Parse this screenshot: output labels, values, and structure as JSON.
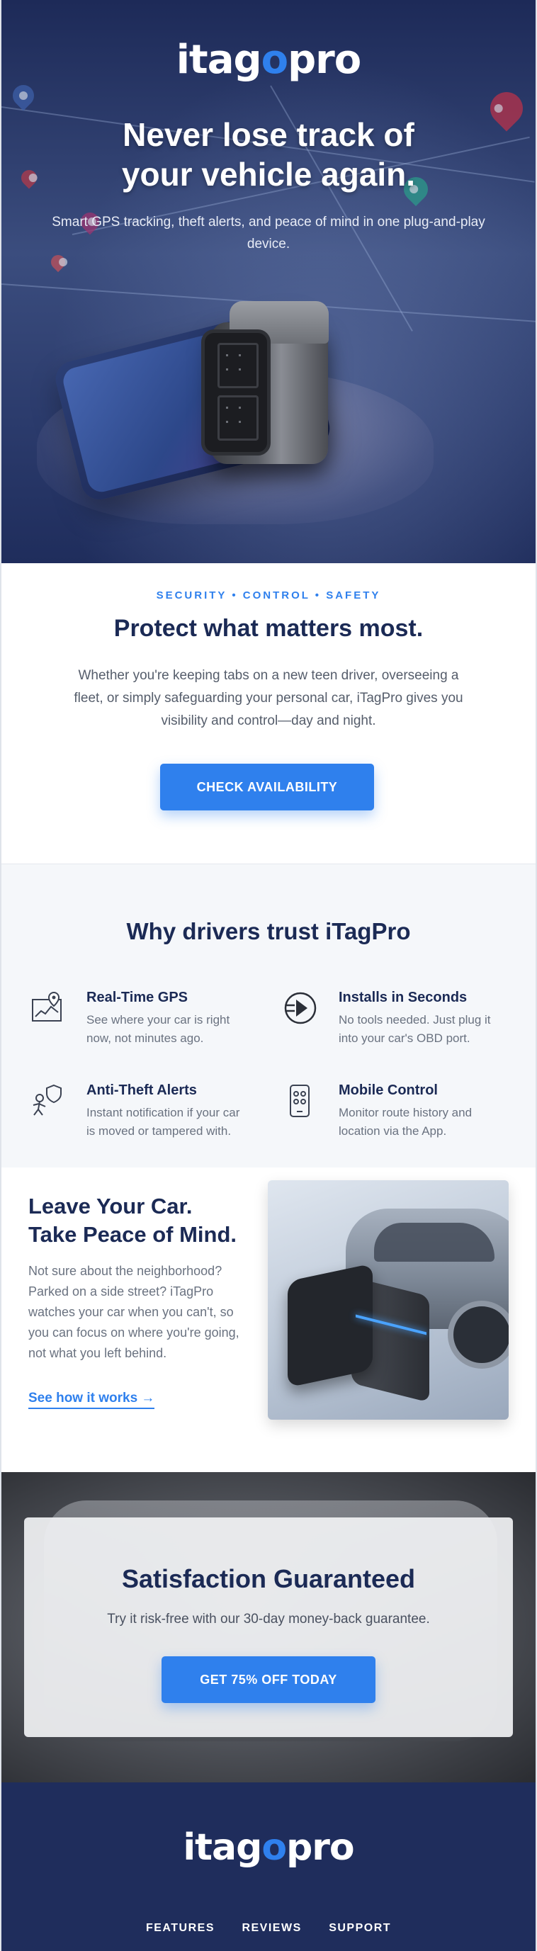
{
  "brand": {
    "logo_pre": "itag",
    "logo_dot": "o",
    "logo_post": "pro",
    "primary_color": "#1f2d5c",
    "accent_color": "#2f80ed"
  },
  "hero": {
    "title_line1": "Never lose track of",
    "title_line2": "your vehicle again.",
    "subtitle": "Smart GPS tracking, theft alerts, and peace of mind in one plug-and-play device."
  },
  "intro": {
    "eyebrow": "SECURITY • CONTROL • SAFETY",
    "title": "Protect what matters most.",
    "body": "Whether you're keeping tabs on a new teen driver, overseeing a fleet, or simply safeguarding your personal car, iTagPro gives you visibility and control—day and night.",
    "cta": "CHECK AVAILABILITY"
  },
  "features": {
    "title": "Why drivers trust iTagPro",
    "items": [
      {
        "icon": "map-gps-icon",
        "heading": "Real-Time GPS",
        "text": "See where your car is right now, not minutes ago."
      },
      {
        "icon": "plug-icon",
        "heading": "Installs in Seconds",
        "text": "No tools needed. Just plug it into your car's OBD port."
      },
      {
        "icon": "shield-thief-icon",
        "heading": "Anti-Theft Alerts",
        "text": "Instant notification if your car is moved or tampered with."
      },
      {
        "icon": "mobile-app-icon",
        "heading": "Mobile Control",
        "text": "Monitor route history and location via the App."
      }
    ]
  },
  "peace": {
    "title_line1": "Leave Your Car.",
    "title_line2": "Take Peace of Mind.",
    "body": "Not sure about the neighborhood? Parked on a side street? iTagPro watches your car when you can't, so you can focus on where you're going, not what you left behind.",
    "link": "See how it works →"
  },
  "guarantee": {
    "title": "Satisfaction Guaranteed",
    "subtitle": "Try it risk-free with our 30-day money-back guarantee.",
    "cta": "GET 75% OFF TODAY"
  },
  "footer": {
    "nav": [
      "FEATURES",
      "REVIEWS",
      "SUPPORT"
    ]
  }
}
